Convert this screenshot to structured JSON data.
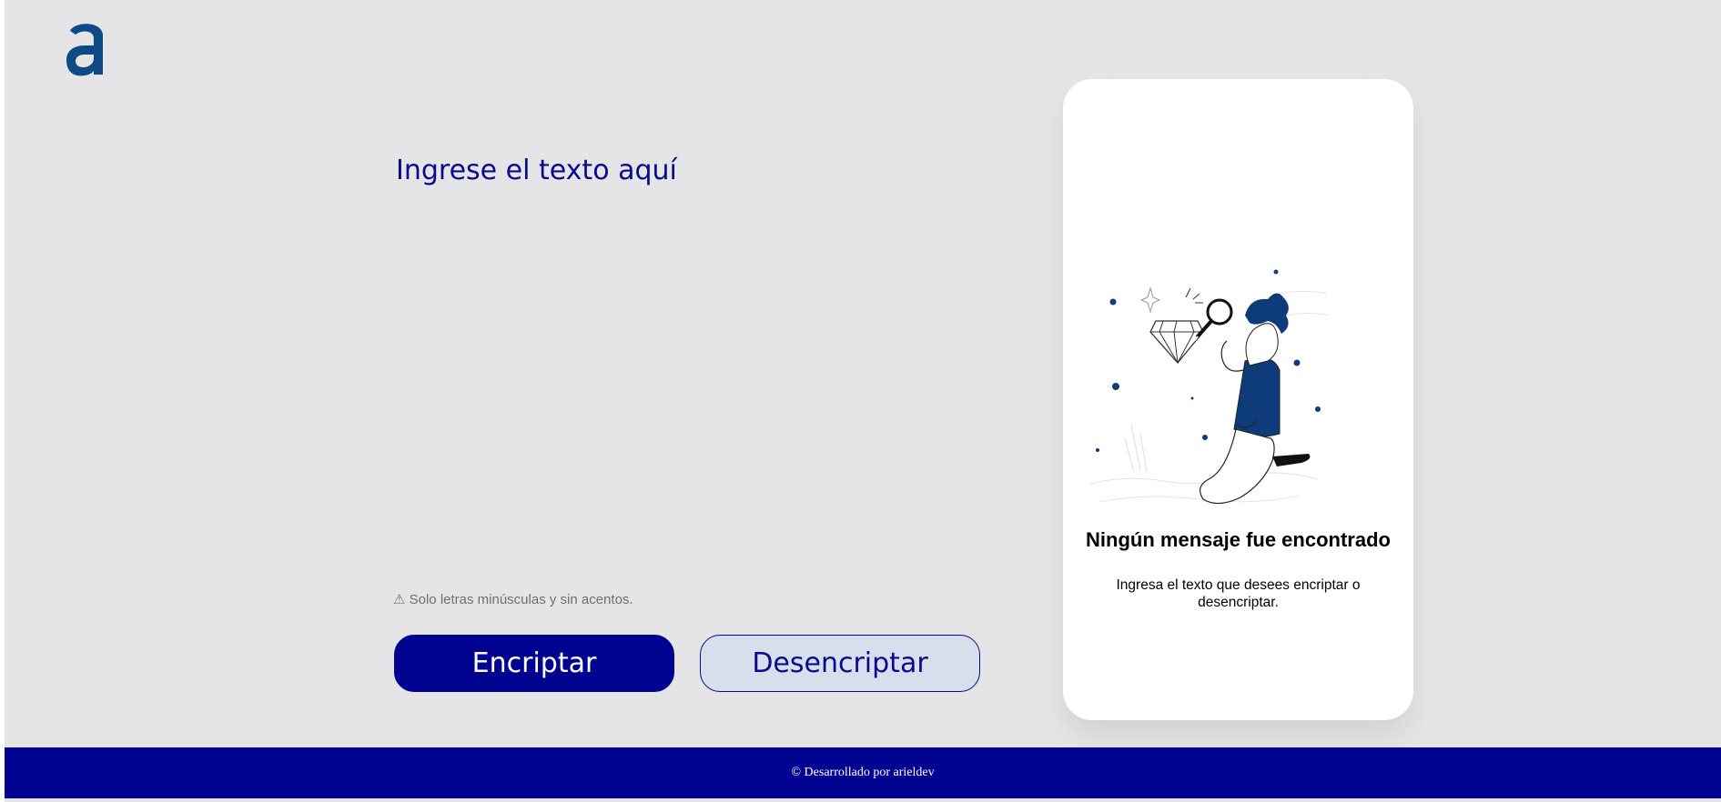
{
  "header": {
    "logo_icon": "alura-a-logo-icon",
    "logo_color": "#0e4a86"
  },
  "input": {
    "placeholder": "Ingrese el texto aquí",
    "value": ""
  },
  "warning": {
    "icon": "warning-triangle-icon",
    "symbol": "⚠",
    "text": "Solo letras minúsculas y sin acentos."
  },
  "buttons": {
    "encrypt_label": "Encriptar",
    "decrypt_label": "Desencriptar"
  },
  "output": {
    "illustration": "person-with-magnifying-glass-illustration",
    "title": "Ningún mensaje fue encontrado",
    "message": "Ingresa el texto que desees encriptar o desencriptar."
  },
  "footer": {
    "text": "© Desarrollado por arieldev"
  },
  "colors": {
    "background": "#e5e5e7",
    "primary": "#000390",
    "secondary_button": "#d8dfec",
    "text_primary": "#0a0a8c",
    "card": "#ffffff"
  }
}
